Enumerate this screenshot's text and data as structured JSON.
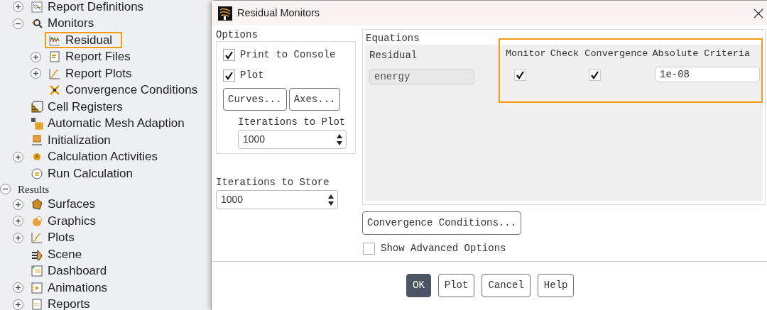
{
  "tree": [
    {
      "kind": "item",
      "label": "Report Definitions",
      "expanded": false,
      "highlighted": false
    },
    {
      "kind": "item",
      "label": "Monitors",
      "expanded": true,
      "highlighted": false,
      "children": [
        {
          "kind": "item",
          "label": "Residual",
          "highlighted": true
        },
        {
          "kind": "item",
          "label": "Report Files",
          "expanded": false,
          "highlighted": false
        },
        {
          "kind": "item",
          "label": "Report Plots",
          "expanded": false,
          "highlighted": false
        },
        {
          "kind": "item",
          "label": "Convergence Conditions",
          "highlighted": false
        }
      ]
    },
    {
      "kind": "item",
      "label": "Cell Registers",
      "highlighted": false
    },
    {
      "kind": "item",
      "label": "Automatic Mesh Adaption",
      "highlighted": false
    },
    {
      "kind": "item",
      "label": "Initialization",
      "highlighted": false
    },
    {
      "kind": "item",
      "label": "Calculation Activities",
      "expanded": false,
      "highlighted": false
    },
    {
      "kind": "item",
      "label": "Run Calculation",
      "highlighted": false
    },
    {
      "kind": "section",
      "label": "Results",
      "expanded": true,
      "highlighted": false,
      "children": [
        {
          "kind": "item",
          "label": "Surfaces",
          "expanded": false,
          "highlighted": false
        },
        {
          "kind": "item",
          "label": "Graphics",
          "expanded": false,
          "highlighted": false
        },
        {
          "kind": "item",
          "label": "Plots",
          "expanded": false,
          "highlighted": false
        },
        {
          "kind": "item",
          "label": "Scene",
          "highlighted": false
        },
        {
          "kind": "item",
          "label": "Dashboard",
          "highlighted": false
        },
        {
          "kind": "item",
          "label": "Animations",
          "expanded": false,
          "highlighted": false
        },
        {
          "kind": "item",
          "label": "Reports",
          "expanded": false,
          "highlighted": false
        }
      ]
    }
  ],
  "dialog": {
    "title": "Residual Monitors",
    "options": {
      "title": "Options",
      "checkboxes": [
        {
          "label": "Print to Console",
          "checked": true
        },
        {
          "label": "Plot",
          "checked": true
        }
      ],
      "buttons": [
        "Curves...",
        "Axes..."
      ],
      "iterations_to_plot": {
        "label": "Iterations to Plot",
        "value": "1000"
      }
    },
    "iterations_to_store": {
      "label": "Iterations to Store",
      "value": "1000"
    },
    "equations": {
      "title": "Equations",
      "highlighted": true,
      "columns": [
        "Residual",
        "Monitor",
        "Check Convergence",
        "Absolute Criteria"
      ],
      "rows": [
        {
          "residual": "energy",
          "monitor": true,
          "check_convergence": true,
          "absolute_criteria": "1e-08"
        }
      ]
    },
    "convergence_button": "Convergence Conditions...",
    "advanced": {
      "label": "Show Advanced Options",
      "checked": false
    },
    "buttons": [
      {
        "label": "OK",
        "kind": "primary"
      },
      {
        "label": "Plot",
        "kind": "normal"
      },
      {
        "label": "Cancel",
        "kind": "normal"
      },
      {
        "label": "Help",
        "kind": "normal"
      }
    ]
  }
}
